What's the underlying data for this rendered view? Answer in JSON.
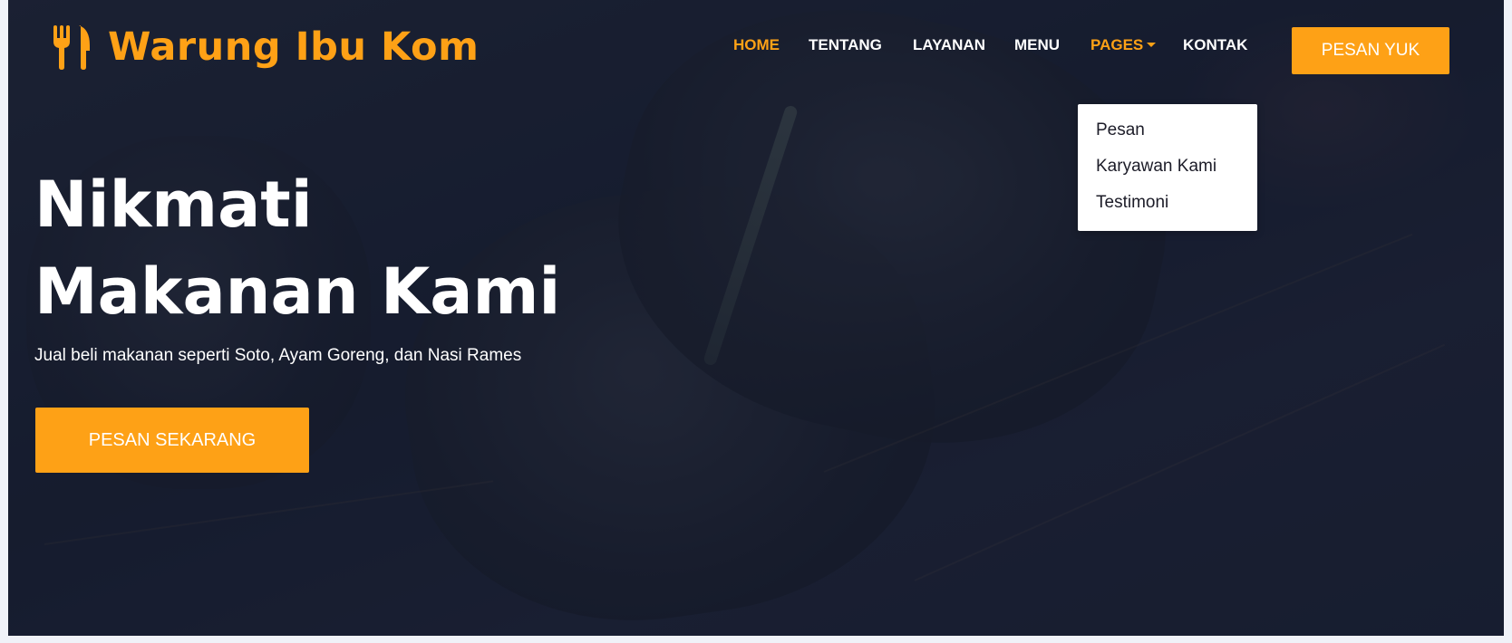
{
  "colors": {
    "accent": "#FEA116",
    "overlay": "#0F172B",
    "text_light": "#FFFFFF",
    "dropdown_text": "#1C1C28"
  },
  "brand": {
    "icon": "utensils-icon",
    "name": "Warung Ibu Kom"
  },
  "nav": {
    "items": [
      {
        "label": "HOME",
        "active": true
      },
      {
        "label": "TENTANG",
        "active": false
      },
      {
        "label": "LAYANAN",
        "active": false
      },
      {
        "label": "MENU",
        "active": false
      },
      {
        "label": "PAGES",
        "active": false,
        "has_dropdown": true
      },
      {
        "label": "KONTAK",
        "active": false
      }
    ],
    "cta_label": "PESAN YUK"
  },
  "dropdown": {
    "items": [
      "Pesan",
      "Karyawan Kami",
      "Testimoni"
    ]
  },
  "hero": {
    "title_line1": "Nikmati",
    "title_line2": "Makanan Kami",
    "subtitle": "Jual beli makanan seperti Soto, Ayam Goreng, dan Nasi Rames",
    "button_label": "PESAN SEKARANG"
  }
}
